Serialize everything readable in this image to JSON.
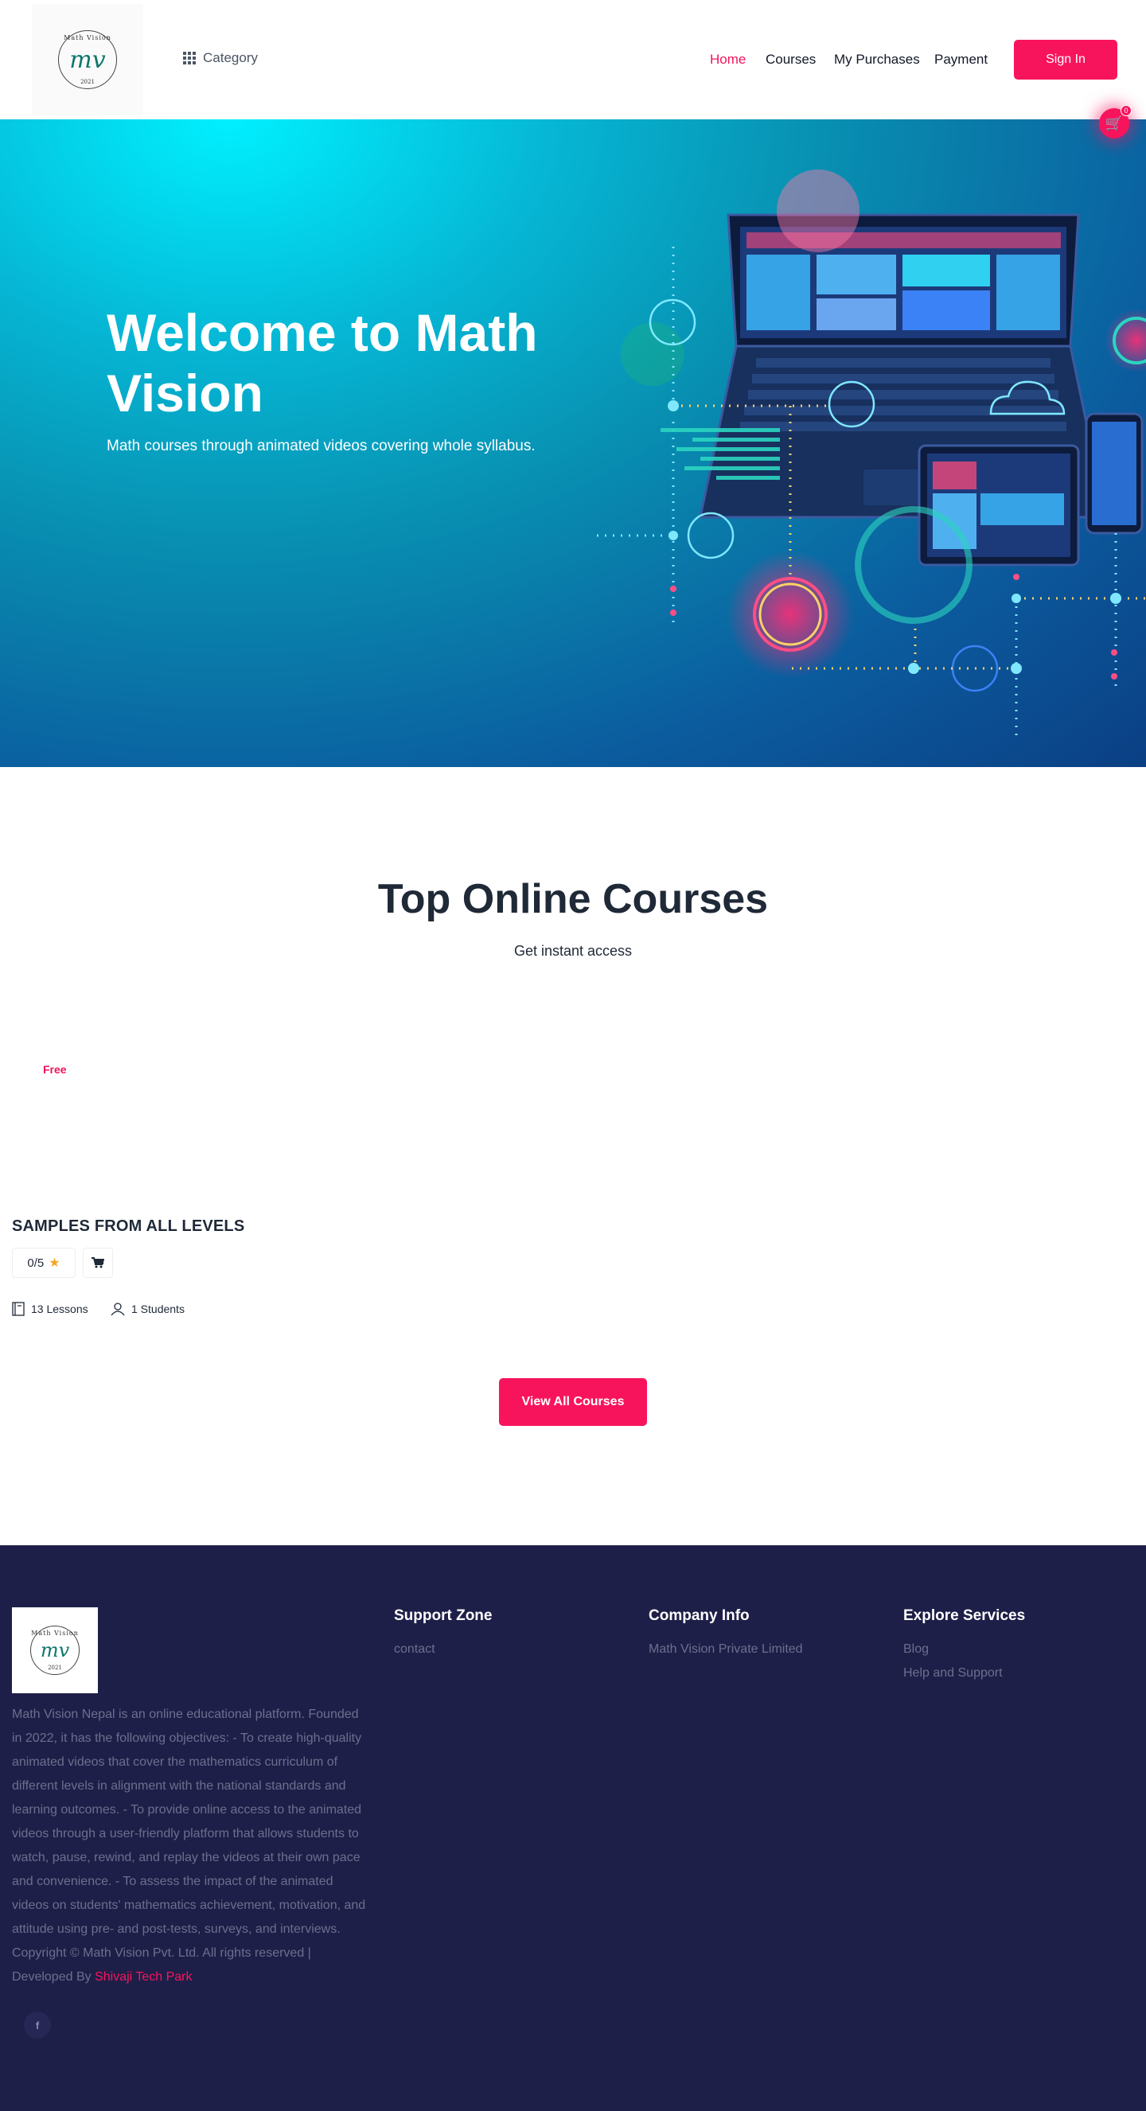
{
  "header": {
    "logo": {
      "top_text": "Math Vision",
      "monogram": "mv",
      "year": "2021"
    },
    "category_label": "Category",
    "nav": [
      {
        "label": "Home",
        "active": true
      },
      {
        "label": "Courses",
        "active": false
      },
      {
        "label": "My Purchases",
        "active": false
      },
      {
        "label": "Payment",
        "active": false
      }
    ],
    "signin_label": "Sign In",
    "cart_count": "0"
  },
  "hero": {
    "title": "Welcome to Math Vision",
    "subtitle": "Math courses through animated videos covering whole syllabus."
  },
  "courses_section": {
    "title": "Top Online Courses",
    "subtitle": "Get instant access",
    "courses": [
      {
        "price_tag": "Free",
        "title": "SAMPLES FROM ALL LEVELS",
        "rating": "0/5",
        "lessons": "13 Lessons",
        "students": "1 Students"
      }
    ],
    "view_all_label": "View All Courses"
  },
  "footer": {
    "description": "Math Vision Nepal is an online educational platform. Founded in 2022, it has the following objectives: - To create high-quality animated videos that cover the mathematics curriculum of different levels in alignment with the national standards and learning outcomes.  - To provide online access to the animated videos through a user-friendly platform that allows students to watch, pause, rewind, and replay the videos at their own pace and convenience.  - To assess the impact of the animated videos on students' mathematics achievement, motivation, and attitude using pre- and post-tests, surveys, and interviews.",
    "copyright": "Copyright © Math Vision Pvt. Ltd. All rights reserved  |  Developed By",
    "developer": "Shivaji Tech Park",
    "columns": [
      {
        "title": "Support Zone",
        "links": [
          "contact"
        ]
      },
      {
        "title": "Company Info",
        "links": [
          "Math Vision Private Limited"
        ]
      },
      {
        "title": "Explore Services",
        "links": [
          "Blog",
          "Help and Support"
        ]
      }
    ]
  },
  "colors": {
    "accent": "#f8145d",
    "footer_bg": "#1e1f48",
    "text_dark": "#1f2937"
  }
}
